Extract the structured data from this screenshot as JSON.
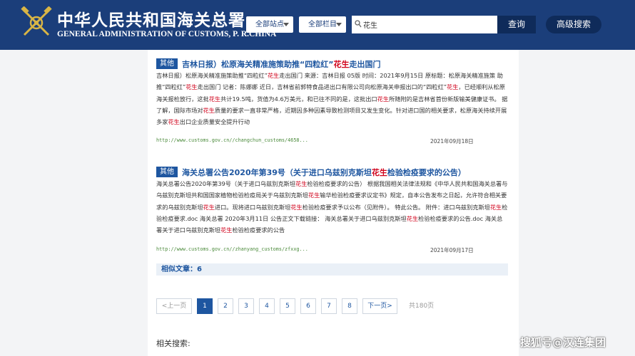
{
  "header": {
    "title_cn": "中华人民共和国海关总署",
    "title_en": "GENERAL ADMINISTRATION OF CUSTOMS, P. R.CHINA",
    "site_select": "全部站点",
    "column_select": "全部栏目",
    "search_value": "花生",
    "search_button": "查询",
    "advanced_button": "高级搜索"
  },
  "results": [
    {
      "tag": "其他",
      "title_pre": "吉林日报）松原海关精准施策助推“四粒红”",
      "title_hl": "花生",
      "title_post": "走出国门",
      "body": [
        {
          "t": "吉林日报）松原海关精准施策助推“四粒红”"
        },
        {
          "t": "花生",
          "h": true
        },
        {
          "t": "走出国门 来源：吉林日报 05版 时间：2021年9月15日 原标题：松原海关精准施策 助推“四粒红”"
        },
        {
          "t": "花生",
          "h": true
        },
        {
          "t": "走出国门 记者：陈娜娜 近日，吉林省前郭特食品进出口有限公司向松原海关申报出口的“四粒红”"
        },
        {
          "t": "花生",
          "h": true
        },
        {
          "t": "，已经顺利从松原海关报检放行，这批"
        },
        {
          "t": "花生",
          "h": true
        },
        {
          "t": "共计19.5吨，货值为4.6万美元，和已往不同的是，这批出口"
        },
        {
          "t": "花生",
          "h": true
        },
        {
          "t": "所随附的是吉林省首份新版输美健康证书。 据了解，国际市场对"
        },
        {
          "t": "花生",
          "h": true
        },
        {
          "t": "质量的要求一直非常严格，近期因多种因素导致检测项目又发生变化。针对进口国的相关要求，松原海关持续开展多家"
        },
        {
          "t": "花生",
          "h": true
        },
        {
          "t": "出口企业质量安全提升行动"
        }
      ],
      "url": "http://www.customs.gov.cn//changchun_customs/4658...",
      "date": "2021年09月18日"
    },
    {
      "tag": "其他",
      "title_pre": "海关总署公告2020年第39号（关于进口乌兹别克斯坦",
      "title_hl": "花生",
      "title_post": "检验检疫要求的公告）",
      "body": [
        {
          "t": "海关总署公告2020年第39号（关于进口乌兹别克斯坦"
        },
        {
          "t": "花生",
          "h": true
        },
        {
          "t": "检验检疫要求的公告） 根据我国相关法律法规和《中华人民共和国海关总署与乌兹别克斯坦共和国国家植物检验检疫局关于乌兹别克斯坦"
        },
        {
          "t": "花生",
          "h": true
        },
        {
          "t": "输华检验检疫要求议定书》规定，自本公告发布之日起，允许符合相关要求的乌兹别克斯坦"
        },
        {
          "t": "花生",
          "h": true
        },
        {
          "t": "进口。现将进口乌兹别克斯坦"
        },
        {
          "t": "花生",
          "h": true
        },
        {
          "t": "检验检疫要求予以公布（见附件）。 特此公告。 附件：进口乌兹别克斯坦"
        },
        {
          "t": "花生",
          "h": true
        },
        {
          "t": "检验检疫要求.doc 海关总署 2020年3月11日 公告正文下载链接： 海关总署关于进口乌兹别克斯坦"
        },
        {
          "t": "花生",
          "h": true
        },
        {
          "t": "检验检疫要求的公告.doc 海关总署关于进口乌兹别克斯坦"
        },
        {
          "t": "花生",
          "h": true
        },
        {
          "t": "检验检疫要求的公告"
        }
      ],
      "url": "http://www.customs.gov.cn//zhanyang_customs/zfxxg...",
      "date": "2021年09月17日"
    }
  ],
  "related_articles": "相似文章：6",
  "pagination": {
    "prev": "<上一页",
    "pages": [
      "1",
      "2",
      "3",
      "4",
      "5",
      "6",
      "7",
      "8"
    ],
    "next": "下一页>",
    "total": "共180页"
  },
  "related_search": "相关搜索:",
  "watermark": "搜狐号@汉连集团"
}
